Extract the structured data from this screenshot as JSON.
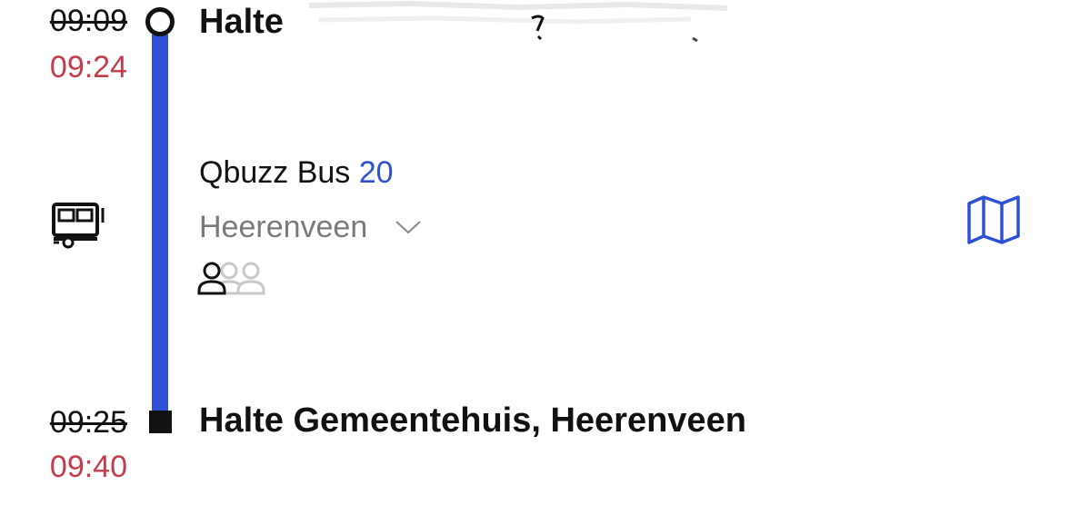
{
  "departure": {
    "scheduled_time": "09:09",
    "actual_time": "09:24",
    "stop_name": "Halte"
  },
  "service": {
    "operator_mode": "Qbuzz Bus",
    "line_number": "20",
    "direction": "Heerenveen"
  },
  "arrival": {
    "scheduled_time": "09:25",
    "actual_time": "09:40",
    "stop_name": "Halte Gemeentehuis, Heerenveen"
  },
  "occupancy": {
    "level": 1,
    "max": 3
  },
  "icons": {
    "mode": "bus-icon",
    "map": "map-icon",
    "expand": "chevron-down-icon",
    "occupancy": "person-icon"
  },
  "colors": {
    "route_line": "#2d50d4",
    "delay_time": "#c43c4c",
    "line_number": "#2d50d4",
    "direction_text": "#7a7a7a",
    "occupancy_inactive": "#c8c8c8"
  }
}
